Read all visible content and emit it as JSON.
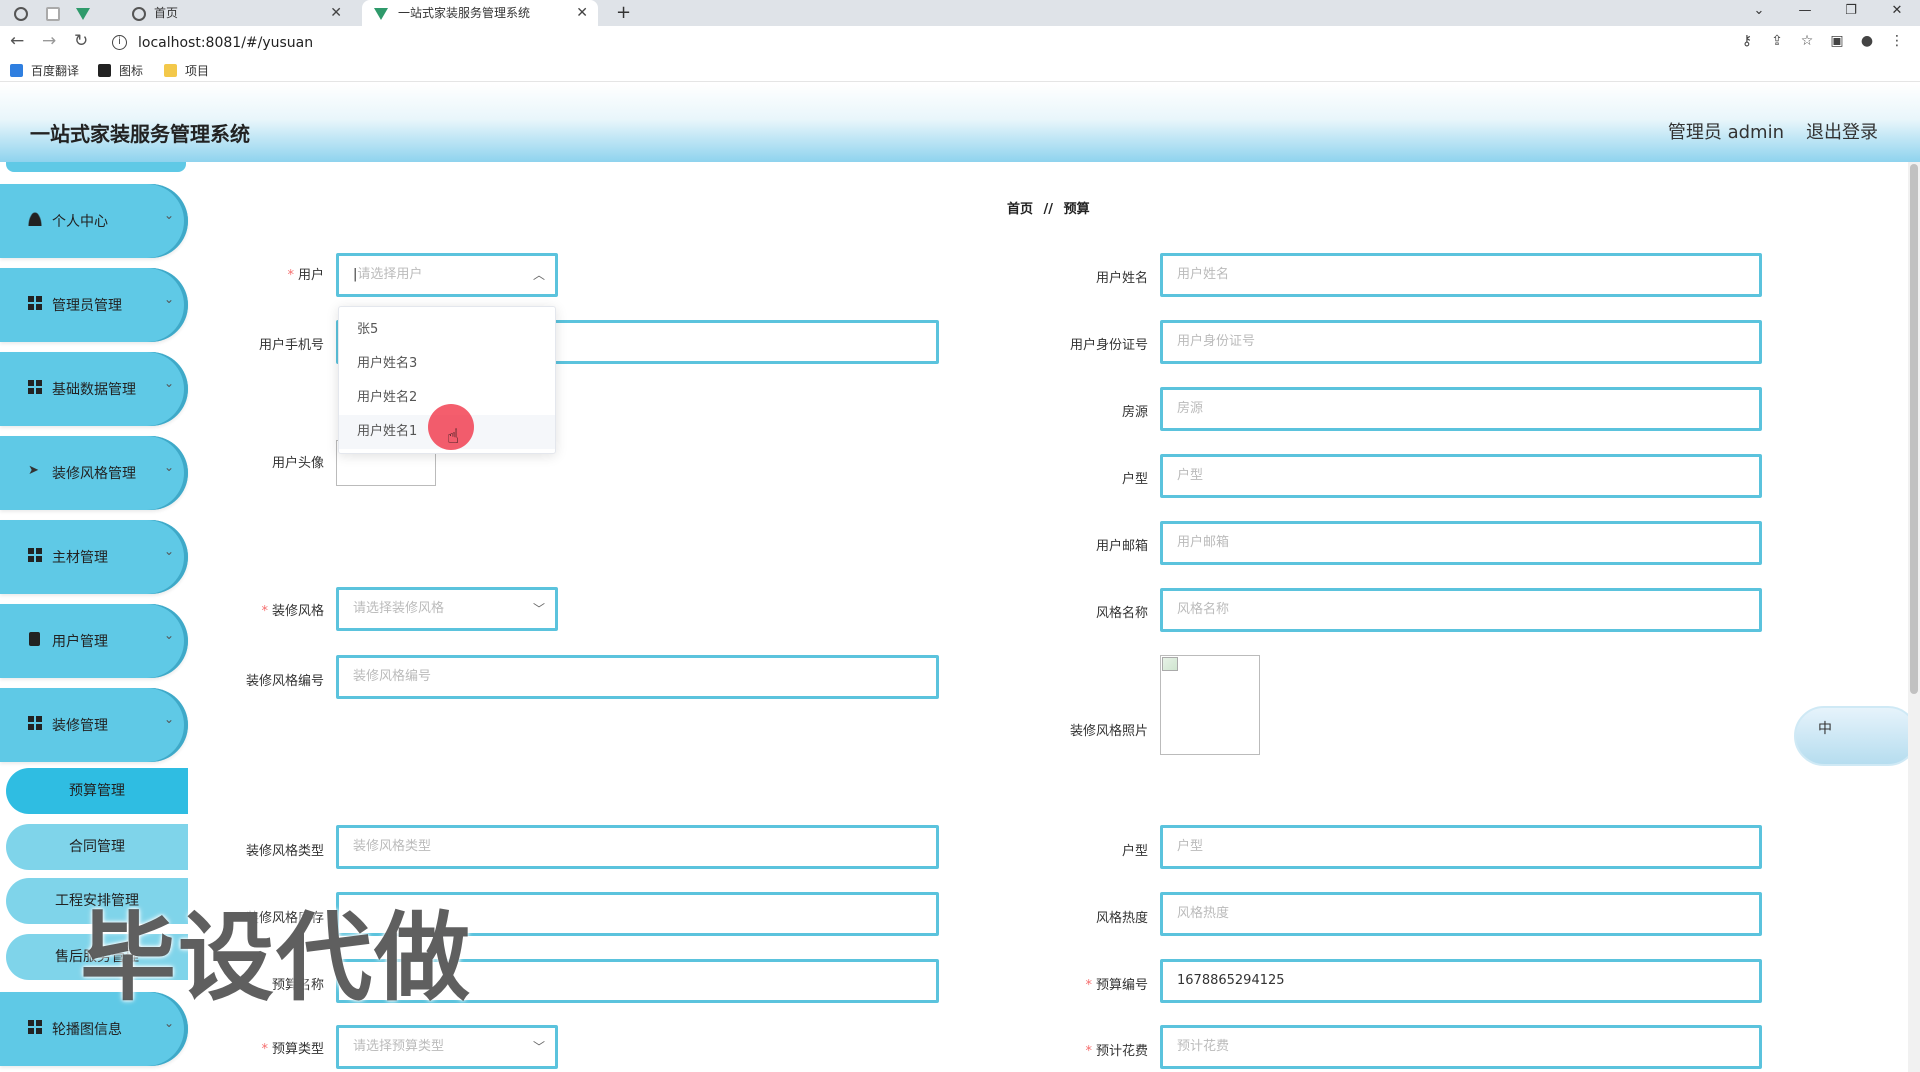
{
  "browser": {
    "tabs": [
      {
        "label": ""
      },
      {
        "label": ""
      },
      {
        "label": ""
      },
      {
        "label": "首页"
      },
      {
        "label": "一站式家装服务管理系统"
      }
    ],
    "new_tab": "+",
    "url": "localhost:8081/#/yusuan",
    "bookmarks": [
      "百度翻译",
      "图标",
      "项目"
    ]
  },
  "header": {
    "title": "一站式家装服务管理系统",
    "user": "管理员 admin",
    "logout": "退出登录"
  },
  "sidebar": {
    "menus": [
      "个人中心",
      "管理员管理",
      "基础数据管理",
      "装修风格管理",
      "主材管理",
      "用户管理",
      "装修管理",
      "轮播图信息"
    ],
    "submenus": [
      "预算管理",
      "合同管理",
      "工程安排管理",
      "售后服务管理"
    ]
  },
  "breadcrumb": {
    "home": "首页",
    "sep": "//",
    "current": "预算"
  },
  "form": {
    "user_label": "用户",
    "user_placeholder": "请选择用户",
    "phone_label": "用户手机号",
    "avatar_label": "用户头像",
    "style_label": "装修风格",
    "style_placeholder": "请选择装修风格",
    "style_no_label": "装修风格编号",
    "style_no_placeholder": "装修风格编号",
    "style_type_label": "装修风格类型",
    "style_type_placeholder": "装修风格类型",
    "style_stock_label": "装修风格库存",
    "budget_name_label": "预算名称",
    "budget_type_label": "预算类型",
    "budget_type_placeholder": "请选择预算类型",
    "username_label": "用户姓名",
    "username_placeholder": "用户姓名",
    "idcard_label": "用户身份证号",
    "idcard_placeholder": "用户身份证号",
    "house_label": "房源",
    "house_placeholder": "房源",
    "layout_label": "户型",
    "layout_placeholder": "户型",
    "email_label": "用户邮箱",
    "email_placeholder": "用户邮箱",
    "stylename_label": "风格名称",
    "stylename_placeholder": "风格名称",
    "stylephoto_label": "装修风格照片",
    "layout2_label": "户型",
    "layout2_placeholder": "户型",
    "heat_label": "风格热度",
    "heat_placeholder": "风格热度",
    "budget_no_label": "预算编号",
    "budget_no_value": "1678865294125",
    "cost_label": "预计花费",
    "cost_placeholder": "预计花费"
  },
  "dropdown": {
    "options": [
      "张5",
      "用户姓名3",
      "用户姓名2",
      "用户姓名1"
    ]
  },
  "watermark": "毕设代做",
  "ime": "中"
}
